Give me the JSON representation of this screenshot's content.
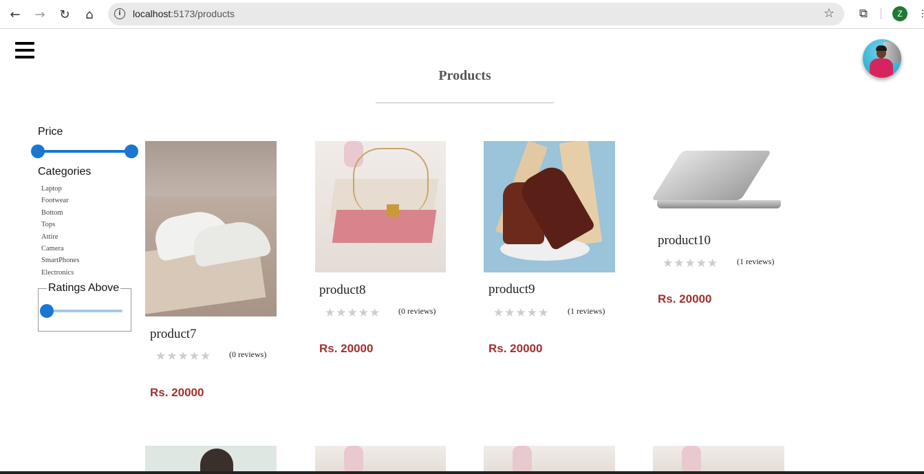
{
  "browser": {
    "url_host": "localhost",
    "url_path": ":5173/products",
    "profile_initial": "Z"
  },
  "page": {
    "title": "Products"
  },
  "filters": {
    "price_label": "Price",
    "price_range": [
      0,
      25000
    ],
    "categories_label": "Categories",
    "categories": [
      "Laptop",
      "Footwear",
      "Bottom",
      "Tops",
      "Attire",
      "Camera",
      "SmartPhones",
      "Electronics"
    ],
    "ratings_label": "Ratings Above",
    "ratings_value": 0
  },
  "products": [
    {
      "name": "product7",
      "reviews": "(0 reviews)",
      "price": "Rs. 20000",
      "rating": 0
    },
    {
      "name": "product8",
      "reviews": "(0 reviews)",
      "price": "Rs. 20000",
      "rating": 0
    },
    {
      "name": "product9",
      "reviews": "(1 reviews)",
      "price": "Rs. 20000",
      "rating": 0
    },
    {
      "name": "product10",
      "reviews": "(1 reviews)",
      "price": "Rs. 20000",
      "rating": 0
    }
  ],
  "colors": {
    "accent": "#1976d2",
    "price": "#a0312e"
  }
}
